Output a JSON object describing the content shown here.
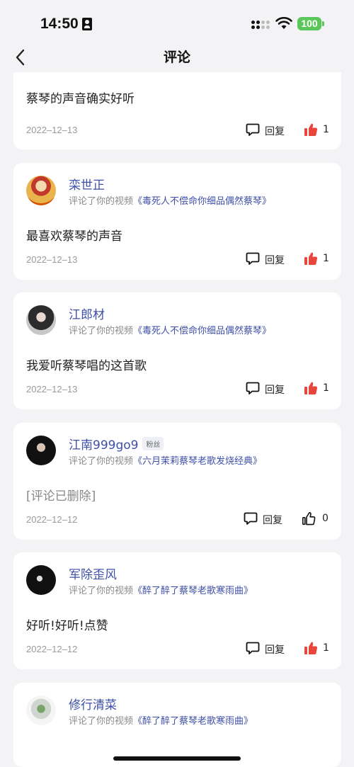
{
  "status_bar": {
    "time": "14:50",
    "battery": "100"
  },
  "nav": {
    "title": "评论"
  },
  "context_prefix": "评论了你的视频",
  "reply_label": "回复",
  "first_card": {
    "comment": "蔡琴的声音确实好听",
    "date": "2022–12–13",
    "likes": "1"
  },
  "comments": [
    {
      "user": "栾世正",
      "badge": "",
      "video": "《毒死人不偿命你细品偶然蔡琴》",
      "comment": "最喜欢蔡琴的声音",
      "date": "2022–12–13",
      "likes": "1",
      "liked": true
    },
    {
      "user": "江郎材",
      "badge": "",
      "video": "《毒死人不偿命你细品偶然蔡琴》",
      "comment": "我爱听蔡琴唱的这首歌",
      "date": "2022–12–13",
      "likes": "1",
      "liked": true
    },
    {
      "user": "江南999go9",
      "badge": "粉丝",
      "video": "《六月茉莉蔡琴老歌发烧经典》",
      "comment": "[评论已删除]",
      "date": "2022–12–12",
      "likes": "0",
      "liked": false
    },
    {
      "user": "军除歪风",
      "badge": "",
      "video": "《醉了醉了蔡琴老歌寒雨曲》",
      "comment": "好听!好听!点赞",
      "date": "2022–12–12",
      "likes": "1",
      "liked": true
    },
    {
      "user": "修行清菜",
      "badge": "",
      "video": "《醉了醉了蔡琴老歌寒雨曲》"
    }
  ],
  "colors": {
    "accent": "#3e4fa8",
    "like_red": "#e8453c",
    "battery_green": "#5bc65a"
  },
  "icons": {
    "back": "chevron-left-icon",
    "reply": "comment-bubble-icon",
    "like": "thumbs-up-icon"
  }
}
